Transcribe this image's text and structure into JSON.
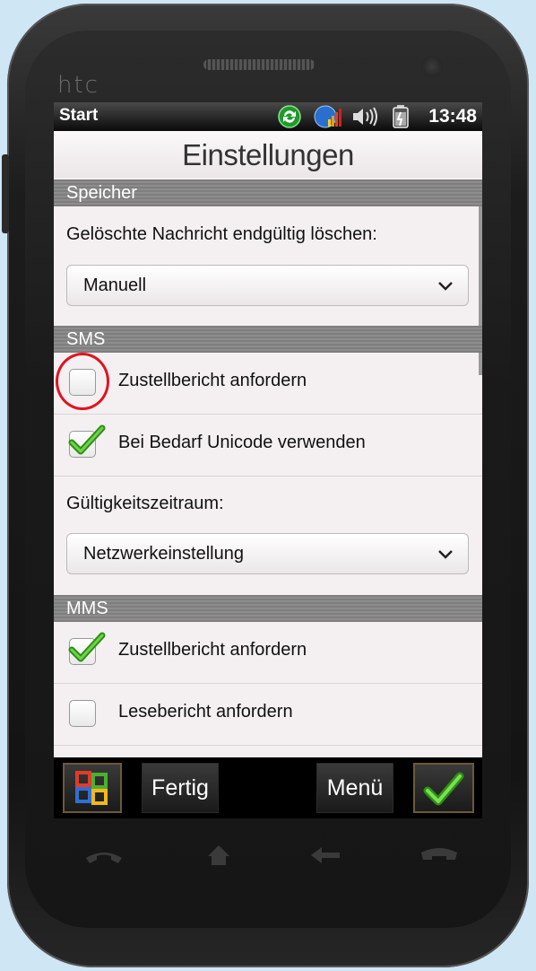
{
  "device": {
    "brand": "htc"
  },
  "statusbar": {
    "start_label": "Start",
    "time": "13:48",
    "icons": [
      "sync-icon",
      "signal-icon",
      "volume-icon",
      "battery-icon"
    ]
  },
  "app": {
    "title": "Einstellungen"
  },
  "sections": {
    "speicher": {
      "header": "Speicher",
      "delete_label": "Gelöschte Nachricht endgültig löschen:",
      "delete_value": "Manuell"
    },
    "sms": {
      "header": "SMS",
      "delivery_report": {
        "label": "Zustellbericht anfordern",
        "checked": false
      },
      "unicode": {
        "label": "Bei Bedarf Unicode verwenden",
        "checked": true
      },
      "validity_label": "Gültigkeitszeitraum:",
      "validity_value": "Netzwerkeinstellung"
    },
    "mms": {
      "header": "MMS",
      "delivery_report": {
        "label": "Zustellbericht anfordern",
        "checked": true
      },
      "read_report": {
        "label": "Lesebericht anfordern",
        "checked": false
      }
    }
  },
  "bottombar": {
    "done_label": "Fertig",
    "menu_label": "Menü"
  },
  "colors": {
    "accent_check": "#3cb51e",
    "highlight_circle": "#e0141e",
    "section_header": "#858585"
  }
}
